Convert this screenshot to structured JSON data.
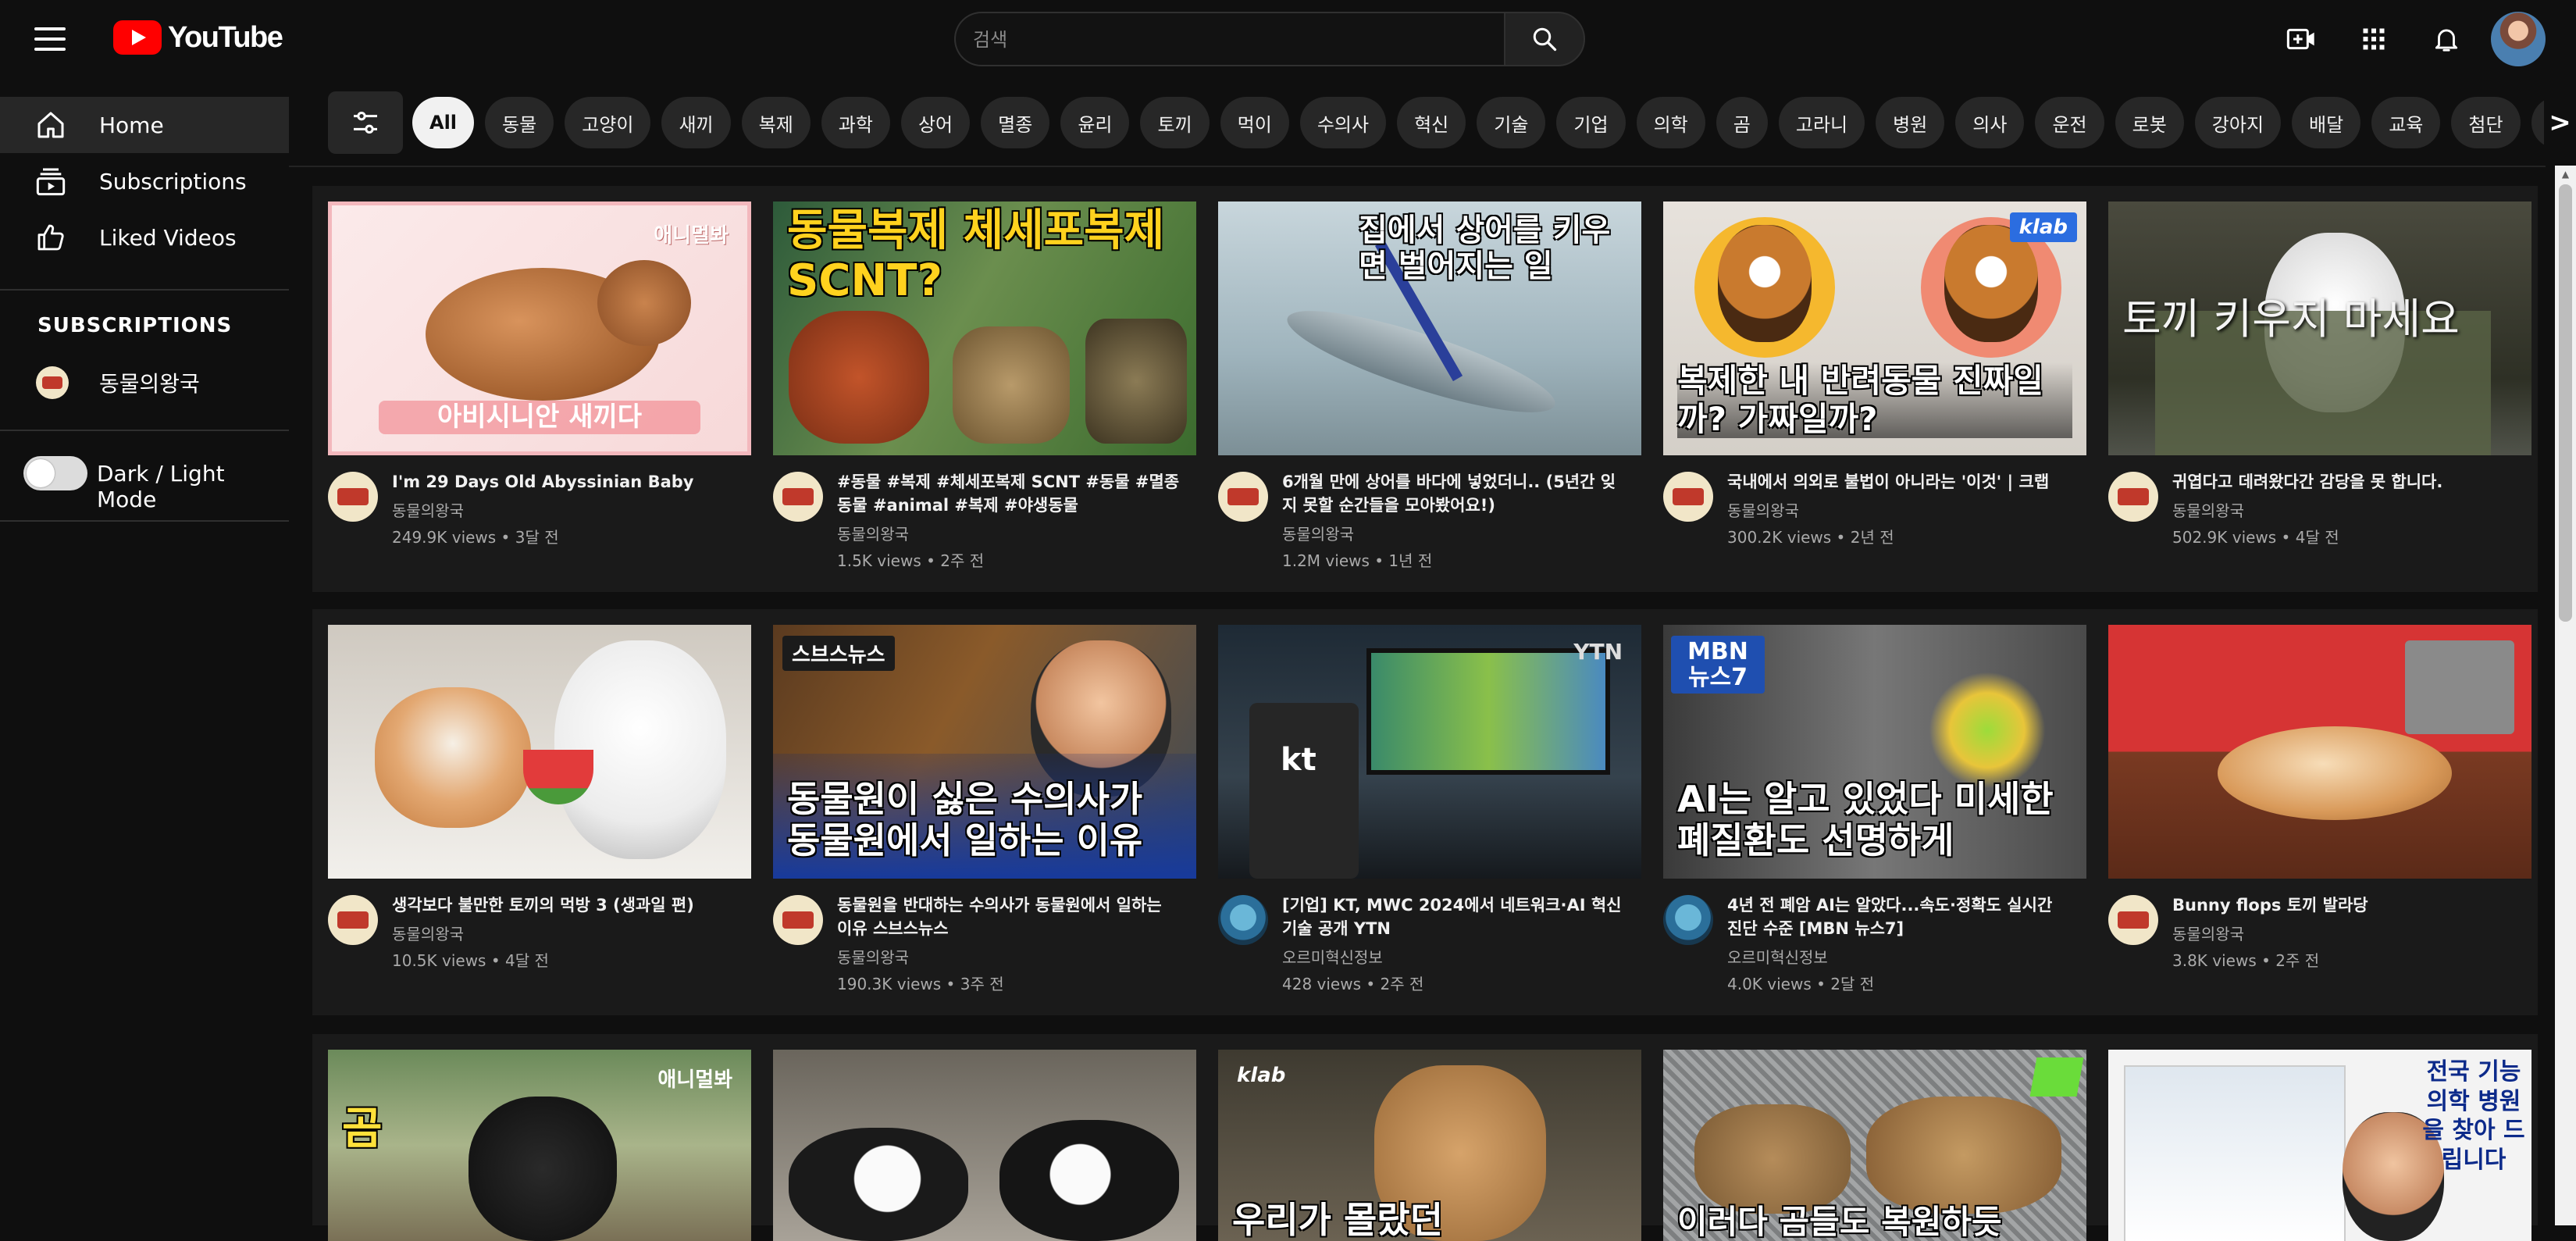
{
  "header": {
    "logo_text": "YouTube",
    "search_placeholder": "검색"
  },
  "sidebar": {
    "items": [
      {
        "label": "Home"
      },
      {
        "label": "Subscriptions"
      },
      {
        "label": "Liked Videos"
      }
    ],
    "subscriptions_header": "SUBSCRIPTIONS",
    "subscriptions": [
      {
        "label": "동물의왕국"
      }
    ],
    "theme_toggle_label": "Dark / Light Mode"
  },
  "chips": [
    "All",
    "동물",
    "고양이",
    "새끼",
    "복제",
    "과학",
    "상어",
    "멸종",
    "윤리",
    "토끼",
    "먹이",
    "수의사",
    "혁신",
    "기술",
    "기업",
    "의학",
    "곰",
    "고라니",
    "병원",
    "의사",
    "운전",
    "로봇",
    "강아지",
    "배달",
    "교육",
    "첨단",
    "뉴스"
  ],
  "chips_more": ">",
  "videos": [
    {
      "title": "I'm 29 Days Old Abyssinian Baby",
      "channel": "동물의왕국",
      "meta": "249.9K views • 3달 전",
      "thumb_text": "아비시니안 새끼다",
      "thumb_badge": "애니멀봐"
    },
    {
      "title": "#동물 #복제 #체세포복제 SCNT #동물 #멸종동물 #animal #복제 #야생동물",
      "channel": "동물의왕국",
      "meta": "1.5K views • 2주 전",
      "thumb_text": "동물복제 체세포복제 SCNT?",
      "thumb_badge": ""
    },
    {
      "title": "6개월 만에 상어를 바다에 넣었더니.. (5년간 잊지 못할 순간들을 모아봤어요!)",
      "channel": "동물의왕국",
      "meta": "1.2M views • 1년 전",
      "thumb_text": "집에서 상어를 키우면 벌어지는 일",
      "thumb_badge": ""
    },
    {
      "title": "국내에서 의외로 불법이 아니라는 '이것' | 크랩",
      "channel": "동물의왕국",
      "meta": "300.2K views • 2년 전",
      "thumb_text": "복제한 내 반려동물 진짜일까? 가짜일까?",
      "thumb_badge": "klab"
    },
    {
      "title": "귀엽다고 데려왔다간 감당을 못 합니다.",
      "channel": "동물의왕국",
      "meta": "502.9K views • 4달 전",
      "thumb_text": "토끼 키우지 마세요",
      "thumb_badge": ""
    },
    {
      "title": "생각보다 불만한 토끼의 먹방 3 (생과일 편)",
      "channel": "동물의왕국",
      "meta": "10.5K views • 4달 전",
      "thumb_text": "",
      "thumb_badge": ""
    },
    {
      "title": "동물원을 반대하는 수의사가 동물원에서 일하는 이유 스브스뉴스",
      "channel": "동물의왕국",
      "meta": "190.3K views • 3주 전",
      "thumb_text": "동물원이 싫은 수의사가 동물원에서 일하는 이유",
      "thumb_badge": "스브스뉴스"
    },
    {
      "title": "[기업] KT, MWC 2024에서 네트워크·AI 혁신 기술 공개 YTN",
      "channel": "오르미혁신정보",
      "meta": "428 views • 2주 전",
      "thumb_text": "",
      "thumb_badge": "YTN"
    },
    {
      "title": "4년 전 폐암 AI는 알았다...속도·정확도 실시간 진단 수준 [MBN 뉴스7]",
      "channel": "오르미혁신정보",
      "meta": "4.0K views • 2달 전",
      "thumb_text": "AI는 알고 있었다 미세한 폐질환도 선명하게",
      "thumb_badge": "MBN 뉴스7"
    },
    {
      "title": "Bunny flops 토끼 발라당",
      "channel": "동물의왕국",
      "meta": "3.8K views • 2주 전",
      "thumb_text": "",
      "thumb_badge": ""
    },
    {
      "title": "",
      "channel": "",
      "meta": "",
      "thumb_text": "곰  퐁",
      "thumb_badge": "애니멀봐"
    },
    {
      "title": "",
      "channel": "",
      "meta": "",
      "thumb_text": "",
      "thumb_badge": ""
    },
    {
      "title": "",
      "channel": "",
      "meta": "",
      "thumb_text": "우리가 몰랐던",
      "thumb_badge": "klab"
    },
    {
      "title": "",
      "channel": "",
      "meta": "",
      "thumb_text": "이러다 곰들도 복원하듯",
      "thumb_badge": ""
    },
    {
      "title": "",
      "channel": "",
      "meta": "",
      "thumb_text": "전국 기능의학 병원을 찾아 드립니다",
      "thumb_badge": ""
    }
  ],
  "colors": {
    "background": "#0f0f0f",
    "card": "#1a1a1a",
    "chip": "#272727",
    "brand_red": "#ff0000"
  },
  "icons": [
    "menu-icon",
    "youtube-logo-icon",
    "search-icon",
    "create-video-icon",
    "apps-grid-icon",
    "bell-icon",
    "home-icon",
    "subscriptions-icon",
    "like-icon",
    "filter-icon"
  ]
}
